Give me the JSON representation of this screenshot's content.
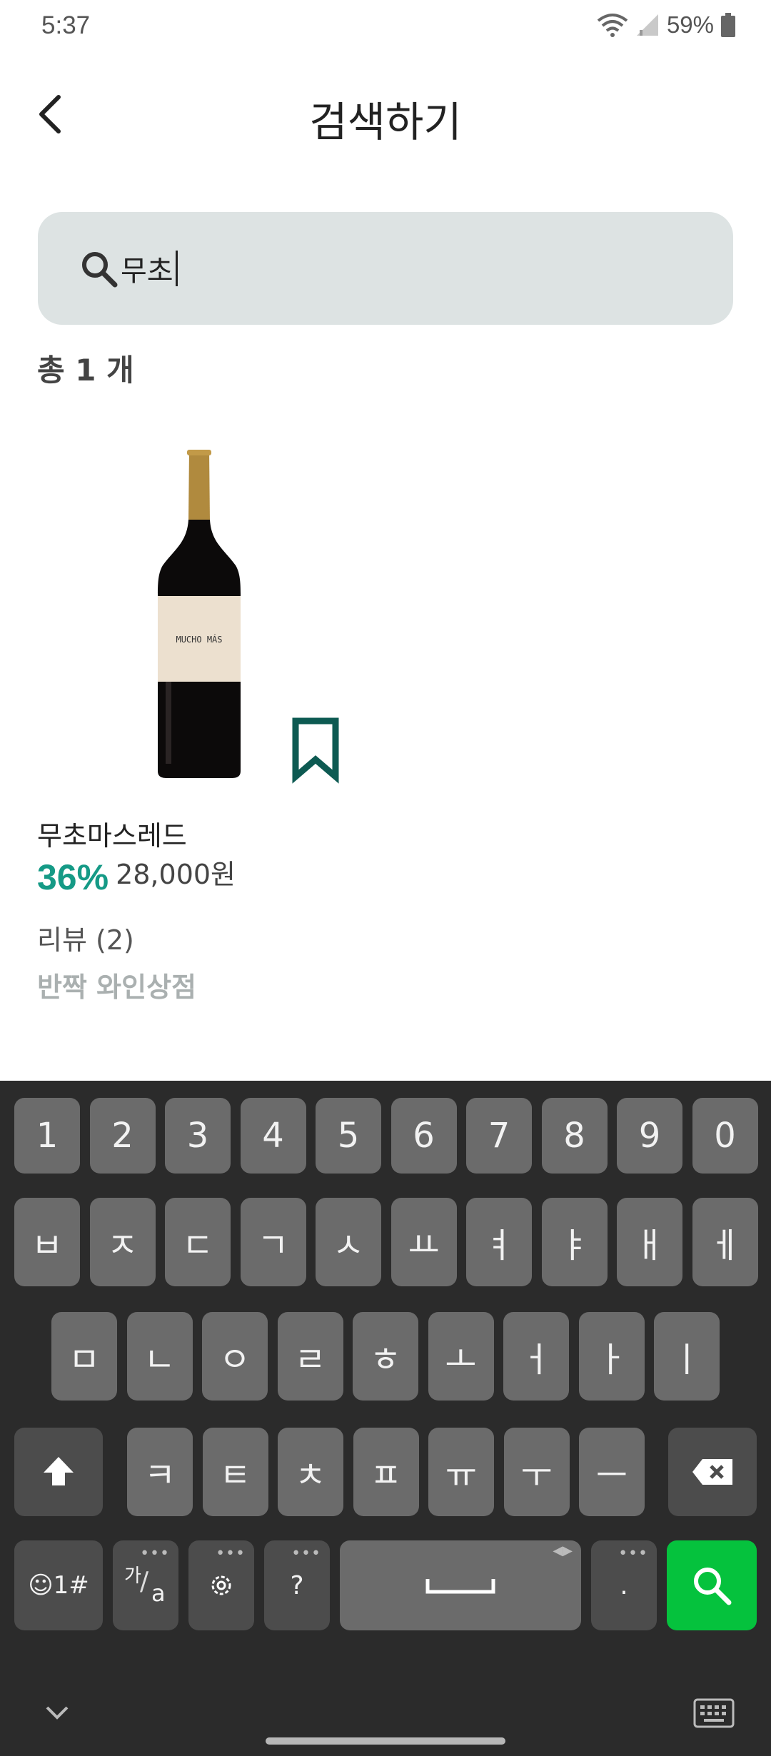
{
  "status": {
    "time": "5:37",
    "battery": "59%"
  },
  "header": {
    "title": "검색하기"
  },
  "search": {
    "query": "무초"
  },
  "results": {
    "count_label": "총 1 개"
  },
  "product": {
    "name": "무초마스레드",
    "discount": "36%",
    "price": "28,000원",
    "reviews": "리뷰 (2)",
    "shop": "반짝 와인상점",
    "bottle_label": "MUCHO MÁS"
  },
  "colors": {
    "accent": "#159a86",
    "bookmark": "#0d5a52",
    "search_bg": "#dde3e3",
    "keyboard_bg": "#2b2b2b",
    "key": "#6b6b6b",
    "search_key": "#05c23d"
  },
  "keyboard": {
    "row1": [
      "1",
      "2",
      "3",
      "4",
      "5",
      "6",
      "7",
      "8",
      "9",
      "0"
    ],
    "row2": [
      "ㅂ",
      "ㅈ",
      "ㄷ",
      "ㄱ",
      "ㅅ",
      "ㅛ",
      "ㅕ",
      "ㅑ",
      "ㅐ",
      "ㅔ"
    ],
    "row3": [
      "ㅁ",
      "ㄴ",
      "ㅇ",
      "ㄹ",
      "ㅎ",
      "ㅗ",
      "ㅓ",
      "ㅏ",
      "ㅣ"
    ],
    "row4": [
      "ㅋ",
      "ㅌ",
      "ㅊ",
      "ㅍ",
      "ㅠ",
      "ㅜ",
      "ㅡ"
    ],
    "symbols_key": "☺1#",
    "lang_key_top": "가",
    "lang_key_bottom": "a",
    "question_key": "?",
    "period_key": "."
  }
}
